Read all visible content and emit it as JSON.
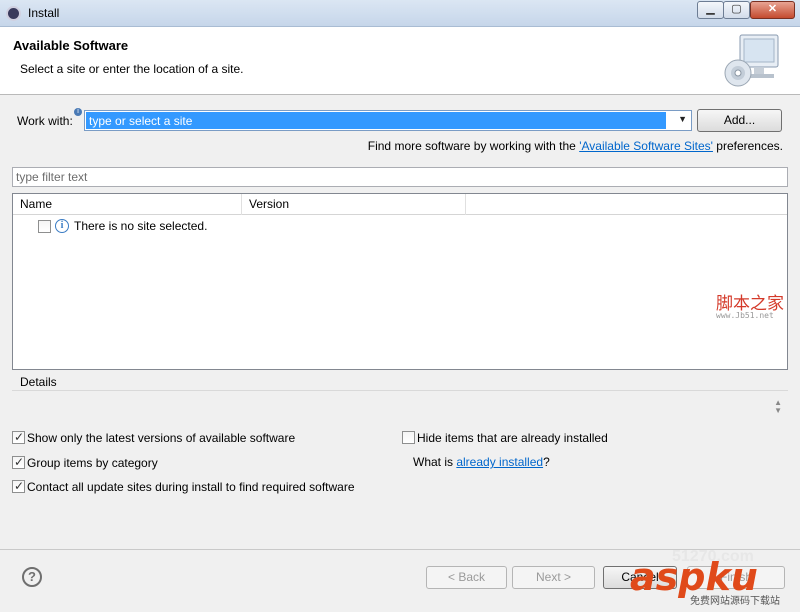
{
  "window": {
    "title": "Install",
    "controls": {
      "minimize": "▁",
      "maximize": "▢",
      "close": "✕"
    }
  },
  "header": {
    "heading": "Available Software",
    "description": "Select a site or enter the location of a site."
  },
  "work_with": {
    "label": "Work with:",
    "placeholder": "type or select a site",
    "add_button": "Add...",
    "find_more_prefix": "Find more software by working with the ",
    "find_more_link": "'Available Software Sites'",
    "find_more_suffix": " preferences."
  },
  "filter": {
    "placeholder": "type filter text"
  },
  "table": {
    "columns": [
      "Name",
      "Version",
      ""
    ],
    "rows": [
      {
        "checked": false,
        "icon": "info-icon",
        "text": "There is no site selected."
      }
    ]
  },
  "details": {
    "label": "Details"
  },
  "options": {
    "latest_only": {
      "label": "Show only the latest versions of available software",
      "checked": true
    },
    "group_by_category": {
      "label": "Group items by category",
      "checked": true
    },
    "contact_all_sites": {
      "label": "Contact all update sites during install to find required software",
      "checked": true
    },
    "hide_installed": {
      "label": "Hide items that are already installed",
      "checked": false
    },
    "what_is_prefix": "What is ",
    "what_is_link": "already installed",
    "what_is_suffix": "?"
  },
  "footer": {
    "back_button": "< Back",
    "next_button": "Next >",
    "cancel_button": "Cancel",
    "finish_button": "Finish"
  },
  "watermarks": {
    "jb51": "脚本之家",
    "jb51_url": "www.Jb51.net",
    "aspku": "aspku",
    "aspku_sub": "免费网站源码下载站",
    "site51": "51270.com"
  }
}
